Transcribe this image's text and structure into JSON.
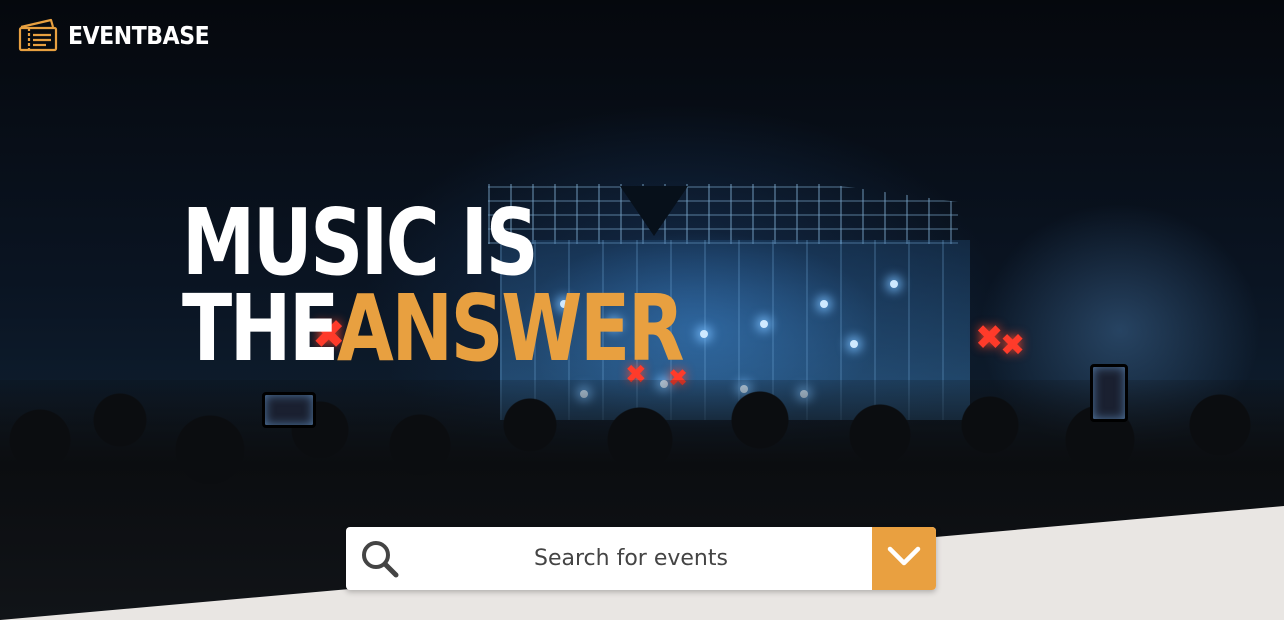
{
  "brand": {
    "name": "EVENTBASE",
    "icon": "ticket-icon"
  },
  "hero": {
    "line1": "MUSIC IS",
    "line2_white": "THE",
    "line2_accent": "ANSWER",
    "accent_color": "#e8a040"
  },
  "search": {
    "placeholder": "Search for events",
    "value": "",
    "icon": "search-icon",
    "dropdown_icon": "chevron-down-icon",
    "dropdown_color": "#e9a040"
  }
}
